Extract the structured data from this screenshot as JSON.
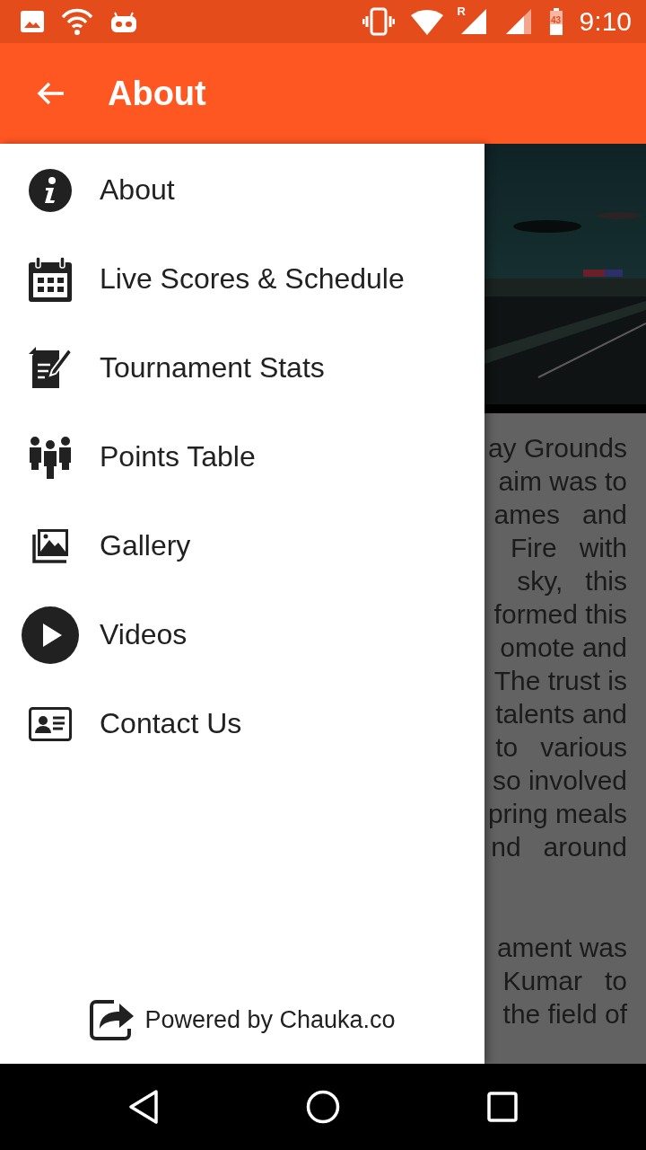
{
  "status_bar": {
    "roaming": "R",
    "battery": "43",
    "time": "9:10"
  },
  "app_bar": {
    "title": "About"
  },
  "drawer": {
    "items": [
      {
        "kind": "info",
        "label": "About"
      },
      {
        "kind": "calendar",
        "label": "Live Scores & Schedule"
      },
      {
        "kind": "edit",
        "label": "Tournament Stats"
      },
      {
        "kind": "people",
        "label": "Points Table"
      },
      {
        "kind": "gallery",
        "label": "Gallery"
      },
      {
        "kind": "play",
        "label": "Videos"
      },
      {
        "kind": "contact",
        "label": "Contact Us"
      }
    ],
    "footer": "Powered by Chauka.co"
  },
  "background_page": {
    "paragraphs": [
      {
        "lines": [
          "ay Grounds",
          "aim was to",
          "ames   and",
          "Fire   with",
          "sky,   this",
          "formed this",
          "omote and",
          "The trust is",
          "talents and",
          "to   various",
          "so involved",
          "pring meals",
          "nd   around"
        ]
      },
      {
        "lines": [
          "ament was",
          "Kumar   to",
          "the field of"
        ]
      }
    ]
  }
}
